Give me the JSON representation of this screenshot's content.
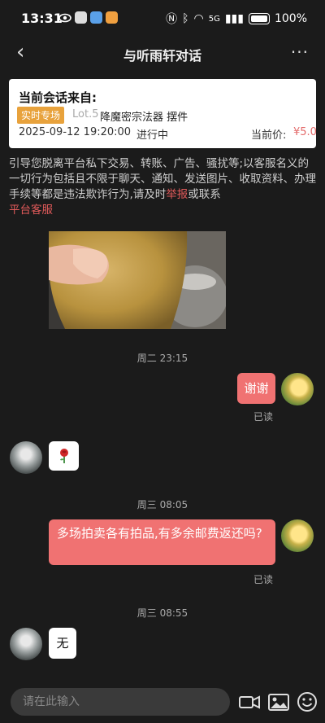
{
  "status_bar": {
    "time": "13:31",
    "battery": "100%",
    "network": "5G"
  },
  "header": {
    "title": "与听雨轩对话",
    "more_label": "···"
  },
  "card": {
    "heading": "当前会话来自:",
    "tag": "实时专场",
    "lot": "Lot.5",
    "item_name": "降魔密宗法器 摆件",
    "datetime": "2025-09-12 19:20:00",
    "status": "进行中",
    "price_label": "当前价:",
    "price": "¥5.0"
  },
  "notice": {
    "text": "引导您脱离平台私下交易、转账、广告、骚扰等;以客服名义的一切行为包括且不限于聊天、通知、发送图片、收取资料、办理手续等都是违法欺诈行为,请及时",
    "report_link": "举报",
    "or_contact": "或联系",
    "service_link": "平台客服"
  },
  "messages": {
    "ts1": "周二 23:15",
    "m1": "谢谢",
    "read1": "已读",
    "ts2": "周三 08:05",
    "m3": "多场拍卖各有拍品,有多余邮费返还吗?",
    "read2": "已读",
    "ts3": "周三 08:55",
    "m4": "无"
  },
  "input": {
    "placeholder": "请在此输入"
  },
  "icons": {
    "emoji_reply": "rose-emoji",
    "video": "video-camera-icon",
    "image": "image-icon",
    "smile": "smiley-icon"
  }
}
